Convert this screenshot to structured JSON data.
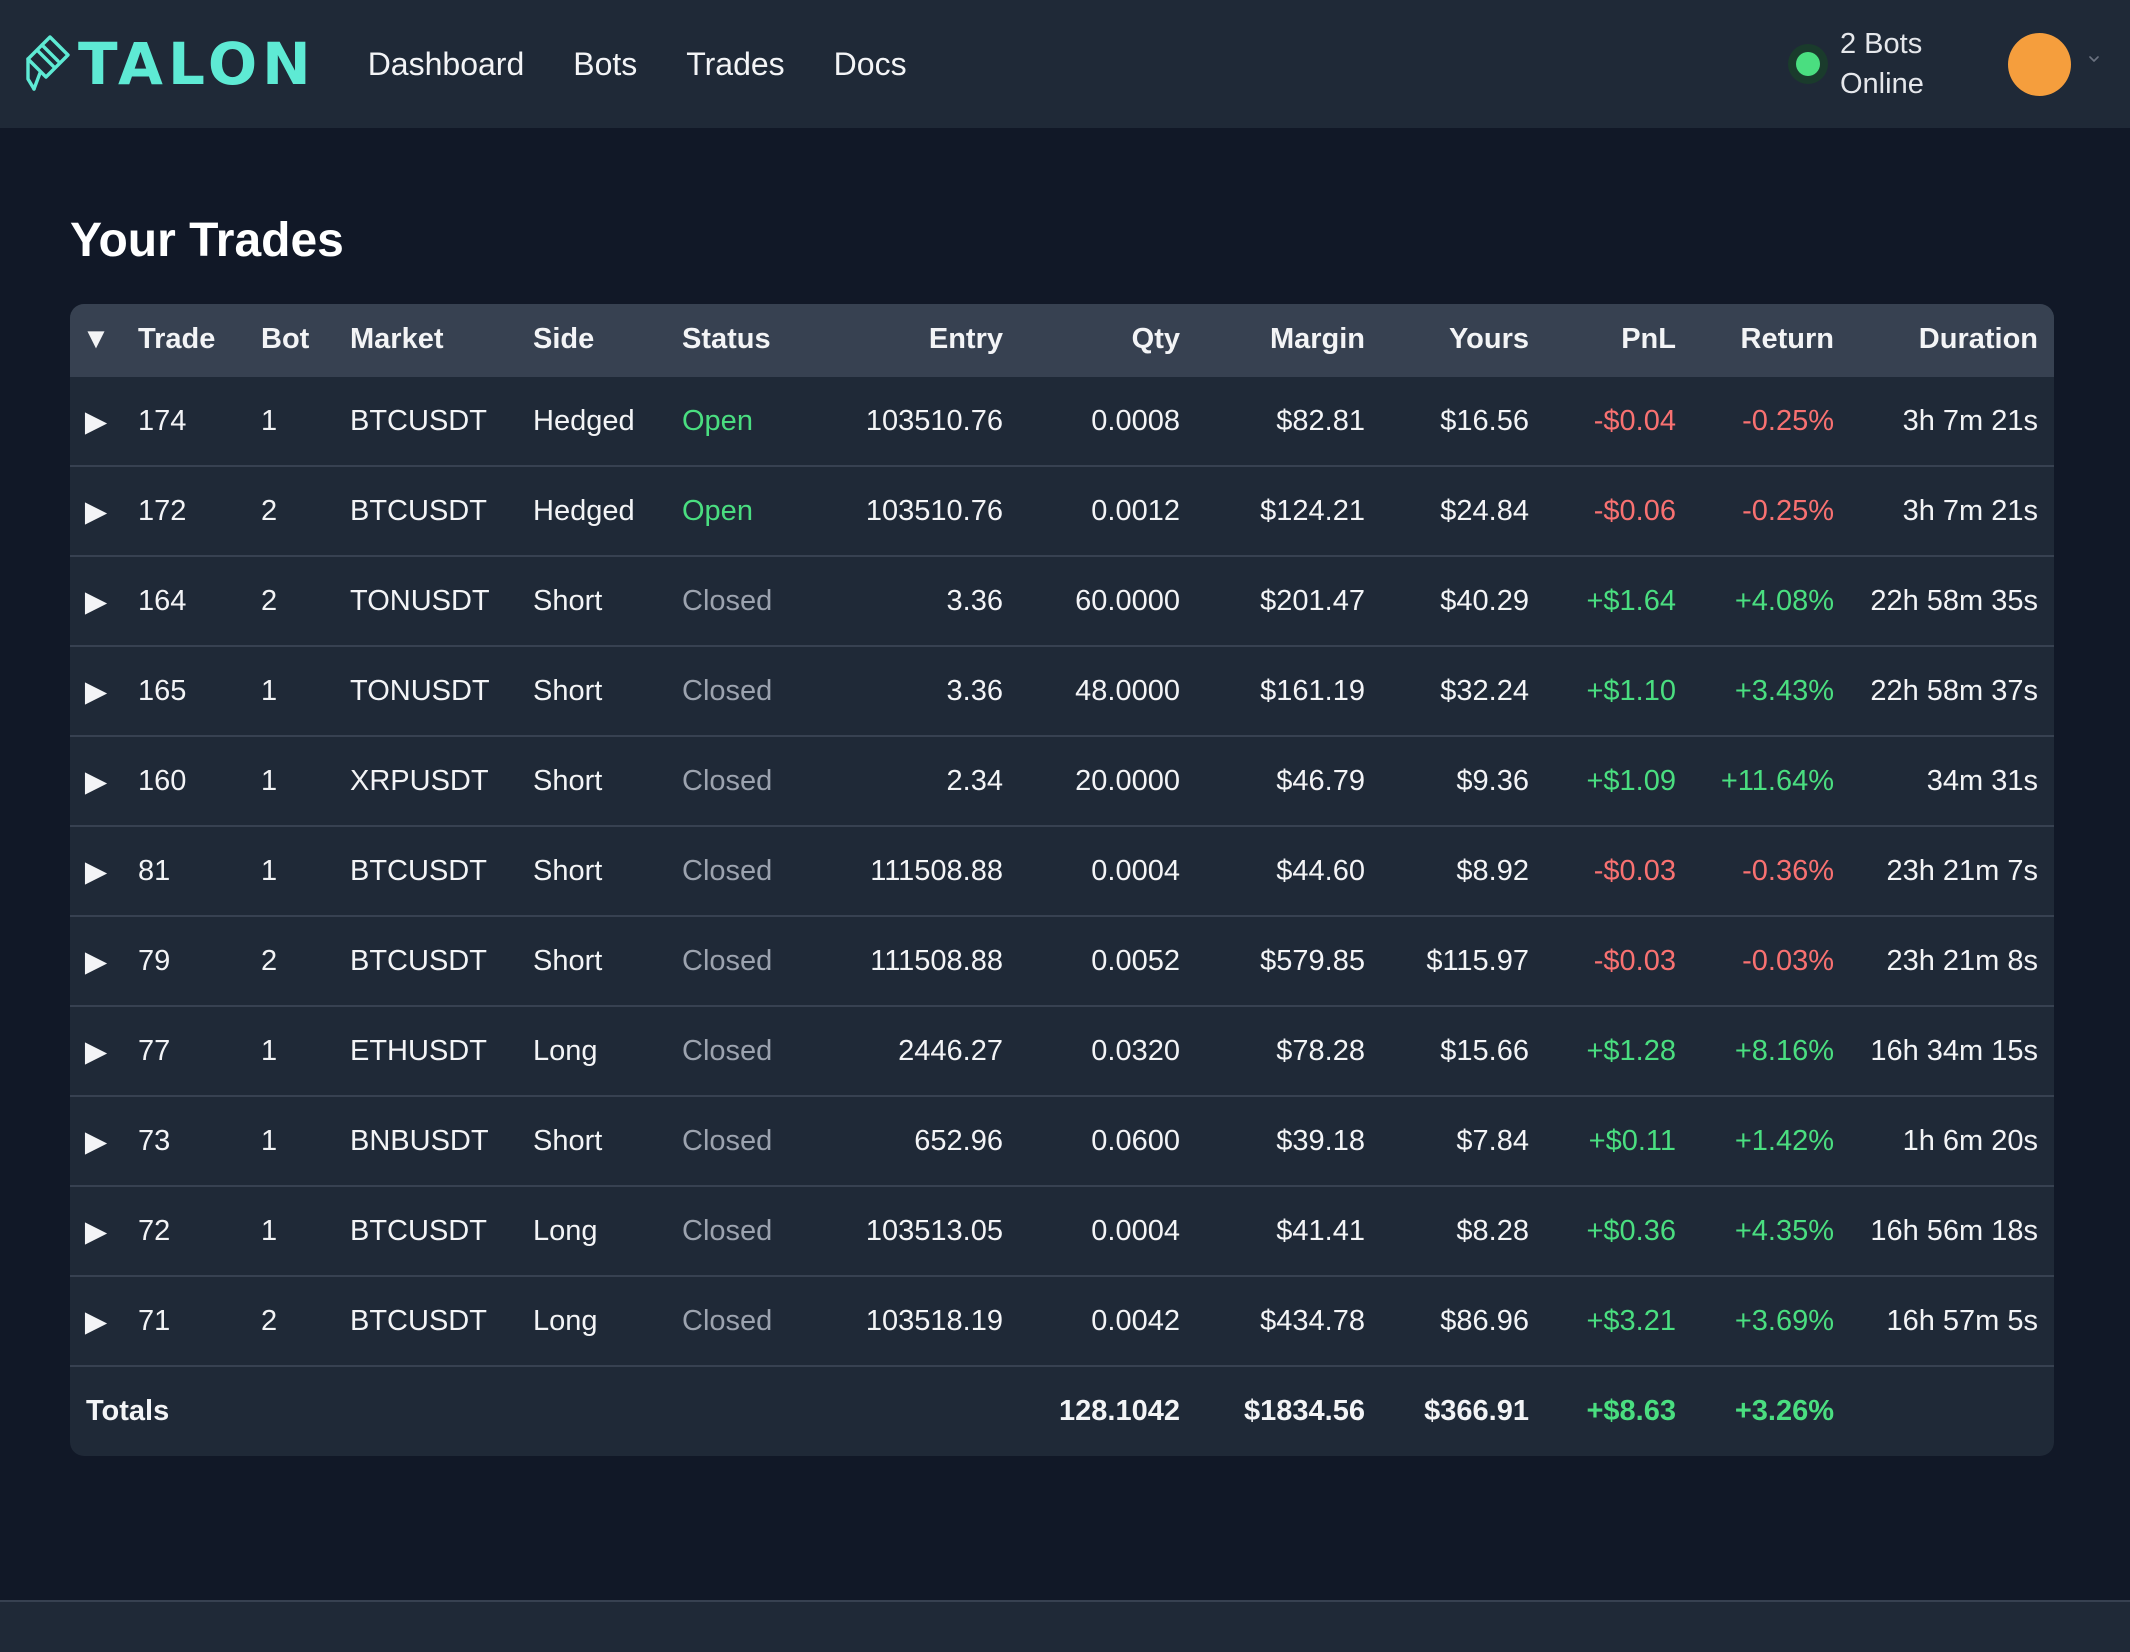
{
  "brand": {
    "name": "TALON",
    "accent": "#5eead4"
  },
  "nav": {
    "links": [
      "Dashboard",
      "Bots",
      "Trades",
      "Docs"
    ]
  },
  "status": {
    "line1": "2 Bots",
    "line2": "Online",
    "color": "#4ade80"
  },
  "avatar": {
    "color": "#f59e3d"
  },
  "page": {
    "title": "Your Trades"
  },
  "table": {
    "sort_icon": "▼",
    "expand_icon": "▶",
    "columns": [
      "Trade",
      "Bot",
      "Market",
      "Side",
      "Status",
      "Entry",
      "Qty",
      "Margin",
      "Yours",
      "PnL",
      "Return",
      "Duration"
    ],
    "rows": [
      {
        "trade": "174",
        "bot": "1",
        "market": "BTCUSDT",
        "side": "Hedged",
        "status": "Open",
        "entry": "103510.76",
        "qty": "0.0008",
        "margin": "$82.81",
        "yours": "$16.56",
        "pnl": "-$0.04",
        "ret": "-0.25%",
        "duration": "3h 7m 21s"
      },
      {
        "trade": "172",
        "bot": "2",
        "market": "BTCUSDT",
        "side": "Hedged",
        "status": "Open",
        "entry": "103510.76",
        "qty": "0.0012",
        "margin": "$124.21",
        "yours": "$24.84",
        "pnl": "-$0.06",
        "ret": "-0.25%",
        "duration": "3h 7m 21s"
      },
      {
        "trade": "164",
        "bot": "2",
        "market": "TONUSDT",
        "side": "Short",
        "status": "Closed",
        "entry": "3.36",
        "qty": "60.0000",
        "margin": "$201.47",
        "yours": "$40.29",
        "pnl": "+$1.64",
        "ret": "+4.08%",
        "duration": "22h 58m 35s"
      },
      {
        "trade": "165",
        "bot": "1",
        "market": "TONUSDT",
        "side": "Short",
        "status": "Closed",
        "entry": "3.36",
        "qty": "48.0000",
        "margin": "$161.19",
        "yours": "$32.24",
        "pnl": "+$1.10",
        "ret": "+3.43%",
        "duration": "22h 58m 37s"
      },
      {
        "trade": "160",
        "bot": "1",
        "market": "XRPUSDT",
        "side": "Short",
        "status": "Closed",
        "entry": "2.34",
        "qty": "20.0000",
        "margin": "$46.79",
        "yours": "$9.36",
        "pnl": "+$1.09",
        "ret": "+11.64%",
        "duration": "34m 31s"
      },
      {
        "trade": "81",
        "bot": "1",
        "market": "BTCUSDT",
        "side": "Short",
        "status": "Closed",
        "entry": "111508.88",
        "qty": "0.0004",
        "margin": "$44.60",
        "yours": "$8.92",
        "pnl": "-$0.03",
        "ret": "-0.36%",
        "duration": "23h 21m 7s"
      },
      {
        "trade": "79",
        "bot": "2",
        "market": "BTCUSDT",
        "side": "Short",
        "status": "Closed",
        "entry": "111508.88",
        "qty": "0.0052",
        "margin": "$579.85",
        "yours": "$115.97",
        "pnl": "-$0.03",
        "ret": "-0.03%",
        "duration": "23h 21m 8s"
      },
      {
        "trade": "77",
        "bot": "1",
        "market": "ETHUSDT",
        "side": "Long",
        "status": "Closed",
        "entry": "2446.27",
        "qty": "0.0320",
        "margin": "$78.28",
        "yours": "$15.66",
        "pnl": "+$1.28",
        "ret": "+8.16%",
        "duration": "16h 34m 15s"
      },
      {
        "trade": "73",
        "bot": "1",
        "market": "BNBUSDT",
        "side": "Short",
        "status": "Closed",
        "entry": "652.96",
        "qty": "0.0600",
        "margin": "$39.18",
        "yours": "$7.84",
        "pnl": "+$0.11",
        "ret": "+1.42%",
        "duration": "1h 6m 20s"
      },
      {
        "trade": "72",
        "bot": "1",
        "market": "BTCUSDT",
        "side": "Long",
        "status": "Closed",
        "entry": "103513.05",
        "qty": "0.0004",
        "margin": "$41.41",
        "yours": "$8.28",
        "pnl": "+$0.36",
        "ret": "+4.35%",
        "duration": "16h 56m 18s"
      },
      {
        "trade": "71",
        "bot": "2",
        "market": "BTCUSDT",
        "side": "Long",
        "status": "Closed",
        "entry": "103518.19",
        "qty": "0.0042",
        "margin": "$434.78",
        "yours": "$86.96",
        "pnl": "+$3.21",
        "ret": "+3.69%",
        "duration": "16h 57m 5s"
      }
    ],
    "totals": {
      "label": "Totals",
      "qty": "128.1042",
      "margin": "$1834.56",
      "yours": "$366.91",
      "pnl": "+$8.63",
      "ret": "+3.26%"
    }
  },
  "colors": {
    "positive": "#4ade80",
    "negative": "#f87171",
    "open": "#4ade80",
    "closed": "#9ca3af"
  }
}
